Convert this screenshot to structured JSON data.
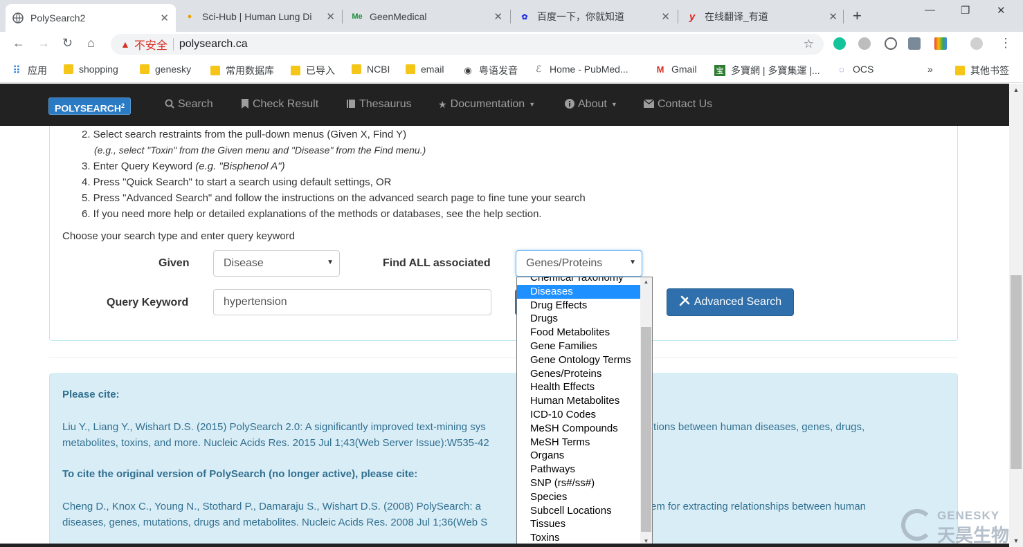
{
  "browser": {
    "tabs": [
      {
        "title": "PolySearch2",
        "icon": "globe-icon",
        "active": true
      },
      {
        "title": "Sci-Hub | Human Lung Di",
        "icon": "scihub-icon"
      },
      {
        "title": "GeenMedical",
        "icon": "geenmedical-icon",
        "badge": "Me"
      },
      {
        "title": "百度一下，你就知道",
        "icon": "baidu-icon"
      },
      {
        "title": "在线翻译_有道",
        "icon": "youdao-icon",
        "badge": "y"
      }
    ],
    "insecure_label": "不安全",
    "url": "polysearch.ca",
    "bookmarks": [
      {
        "label": "应用",
        "type": "apps"
      },
      {
        "label": "shopping",
        "type": "folder"
      },
      {
        "label": "genesky",
        "type": "folder"
      },
      {
        "label": "常用数据库",
        "type": "folder"
      },
      {
        "label": "已导入",
        "type": "folder"
      },
      {
        "label": "NCBI",
        "type": "folder"
      },
      {
        "label": "email",
        "type": "folder"
      },
      {
        "label": "粤语发音",
        "type": "globe"
      },
      {
        "label": "Home - PubMed...",
        "type": "pubmed"
      },
      {
        "label": "Gmail",
        "type": "gmail"
      },
      {
        "label": "多寶網 | 多寶集運 |...",
        "type": "duobao"
      },
      {
        "label": "OCS",
        "type": "ocs"
      }
    ],
    "more_bookmarks": "»",
    "other_bookmarks": "其他书签"
  },
  "nav": {
    "brand": "POLYSEARCH",
    "brand_sup": "2",
    "items": [
      {
        "label": "Search",
        "icon": "search-icon"
      },
      {
        "label": "Check Result",
        "icon": "bookmark-icon"
      },
      {
        "label": "Thesaurus",
        "icon": "book-icon"
      },
      {
        "label": "Documentation",
        "icon": "star-icon",
        "dropdown": true
      },
      {
        "label": "About",
        "icon": "info-icon",
        "dropdown": true
      },
      {
        "label": "Contact Us",
        "icon": "envelope-icon"
      }
    ]
  },
  "instructions": {
    "step2": "2. Select search restraints from the pull-down menus (Given X, Find Y)",
    "step2_example": "(e.g., select \"Toxin\" from the Given menu and \"Disease\" from the Find menu.)",
    "step3": "3. Enter Query Keyword ",
    "step3_example": "(e.g. \"Bisphenol A\")",
    "step4": "4. Press \"Quick Search\" to start a search using default settings, OR",
    "step5": "5. Press \"Advanced Search\" and follow the instructions on the advanced search page to fine tune your search",
    "step6": "6. If you need more help or detailed explanations of the methods or databases, see the help section."
  },
  "form": {
    "prompt": "Choose your search type and enter query keyword",
    "given_label": "Given",
    "given_value": "Disease",
    "find_label": "Find ALL associated",
    "find_value": "Genes/Proteins",
    "keyword_label": "Query Keyword",
    "keyword_value": "hypertension",
    "advanced_button": "Advanced Search"
  },
  "find_options": {
    "partial_top": "Chemical Taxonomy",
    "selected": "Diseases",
    "items": [
      "Diseases",
      "Drug Effects",
      "Drugs",
      "Food Metabolites",
      "Gene Families",
      "Gene Ontology Terms",
      "Genes/Proteins",
      "Health Effects",
      "Human Metabolites",
      "ICD-10 Codes",
      "MeSH Compounds",
      "MeSH Terms",
      "Organs",
      "Pathways",
      "SNP (rs#/ss#)",
      "Species",
      "Subcell Locations",
      "Tissues",
      "Toxins"
    ]
  },
  "citation": {
    "heading1": "Please cite:",
    "text1a": "Liu Y., Liang Y., Wishart D.S. (2015) PolySearch 2.0: A significantly improved text-mining sys",
    "text1b": "tions between human diseases, genes, drugs,",
    "text1c": "metabolites, toxins, and more. Nucleic Acids Res. 2015 Jul 1;43(Web Server Issue):W535-42",
    "heading2": "To cite the original version of PolySearch (no longer active), please cite:",
    "text2a": "Cheng D., Knox C., Young N., Stothard P., Damaraju S., Wishart D.S. (2008) PolySearch: a",
    "text2b": "em for extracting relationships between human",
    "text2c": "diseases, genes, mutations, drugs and metabolites. Nucleic Acids Res. 2008 Jul 1;36(Web S"
  },
  "watermark": {
    "en": "GENESKY",
    "cn": "天昊生物"
  },
  "colors": {
    "navbar": "#222222",
    "brand": "#2a7ac4",
    "button": "#2f6fab",
    "cite_bg": "#d9edf7",
    "selected_option": "#1e90ff"
  }
}
